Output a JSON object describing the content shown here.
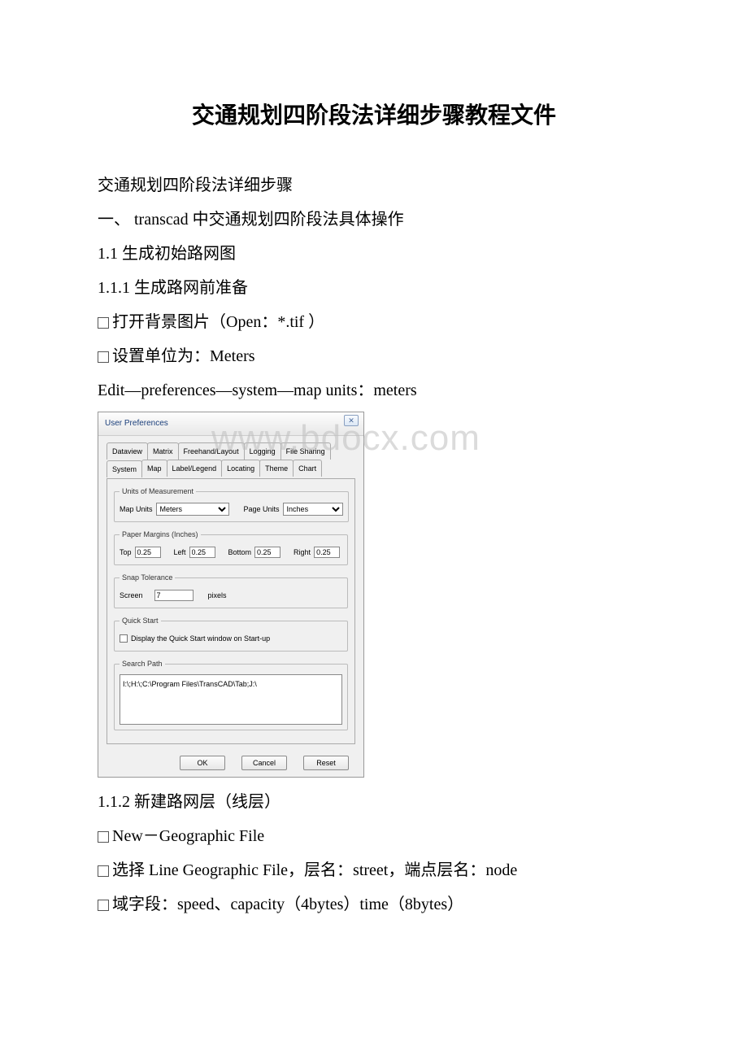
{
  "title": "交通规划四阶段法详细步骤教程文件",
  "body": {
    "p1": "交通规划四阶段法详细步骤",
    "p2": "一、 transcad 中交通规划四阶段法具体操作",
    "p3": "1.1 生成初始路网图",
    "p4": "1.1.1 生成路网前准备",
    "p5": "打开背景图片（Open：*.tif ）",
    "p6": "设置单位为：Meters",
    "p7": "Edit—preferences—system—map units：meters",
    "p8": "1.1.2 新建路网层（线层）",
    "p9": "New－Geographic File",
    "p10": "选择 Line Geographic File，层名：street，端点层名：node",
    "p11": "域字段：speed、capacity（4bytes）time（8bytes）"
  },
  "watermark": "www.bdocx.com",
  "dialog": {
    "title": "User Preferences",
    "close": "✕",
    "tabs_row1": [
      "Dataview",
      "Matrix",
      "Freehand/Layout",
      "Logging",
      "File Sharing"
    ],
    "tabs_row2": [
      "System",
      "Map",
      "Label/Legend",
      "Locating",
      "Theme",
      "Chart"
    ],
    "units": {
      "legend": "Units of Measurement",
      "map_label": "Map Units",
      "map_value": "Meters",
      "page_label": "Page Units",
      "page_value": "Inches"
    },
    "margins": {
      "legend": "Paper Margins (Inches)",
      "top_label": "Top",
      "top_value": "0.25",
      "left_label": "Left",
      "left_value": "0.25",
      "bottom_label": "Bottom",
      "bottom_value": "0.25",
      "right_label": "Right",
      "right_value": "0.25"
    },
    "snap": {
      "legend": "Snap Tolerance",
      "screen_label": "Screen",
      "screen_value": "7",
      "pixels_label": "pixels"
    },
    "quick": {
      "legend": "Quick Start",
      "text": "Display the Quick Start window on Start-up"
    },
    "search": {
      "legend": "Search Path",
      "value": "I:\\;H:\\;C:\\Program Files\\TransCAD\\Tab;J:\\"
    },
    "buttons": {
      "ok": "OK",
      "cancel": "Cancel",
      "reset": "Reset"
    }
  }
}
